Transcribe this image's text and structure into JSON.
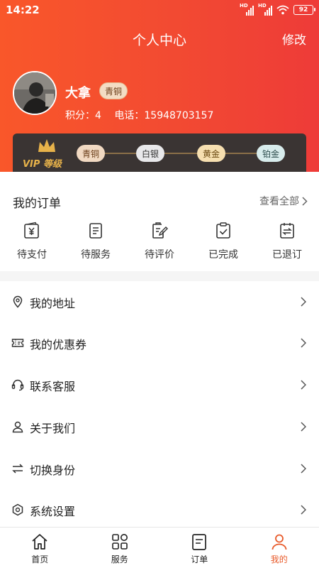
{
  "status_bar": {
    "time": "14:22",
    "hd1": "HD",
    "hd2": "HD",
    "battery": "92"
  },
  "nav": {
    "title": "个人中心",
    "edit_label": "修改"
  },
  "user": {
    "name": "大拿",
    "level": "青铜",
    "points": "积分：4",
    "phone": "电话：15948703157"
  },
  "vip": {
    "label": "VIP 等级",
    "levels": [
      {
        "name": "青铜",
        "bg": "#f1d9c2",
        "fg": "#6b3e1a"
      },
      {
        "name": "白银",
        "bg": "#e8e8ea",
        "fg": "#333333"
      },
      {
        "name": "黄金",
        "bg": "#f6dfb0",
        "fg": "#6b4a12"
      },
      {
        "name": "铂金",
        "bg": "#d8ecec",
        "fg": "#2f4f4f"
      }
    ]
  },
  "orders": {
    "title": "我的订单",
    "view_all": "查看全部",
    "items": [
      {
        "label": "待支付",
        "icon": "wallet-yen-icon"
      },
      {
        "label": "待服务",
        "icon": "document-icon"
      },
      {
        "label": "待评价",
        "icon": "edit-document-icon"
      },
      {
        "label": "已完成",
        "icon": "clipboard-check-icon"
      },
      {
        "label": "已退订",
        "icon": "refund-icon"
      }
    ]
  },
  "menu": [
    {
      "label": "我的地址",
      "icon": "location-pin-icon"
    },
    {
      "label": "我的优惠券",
      "icon": "coupon-icon"
    },
    {
      "label": "联系客服",
      "icon": "headset-icon"
    },
    {
      "label": "关于我们",
      "icon": "person-icon"
    },
    {
      "label": "切换身份",
      "icon": "switch-arrows-icon"
    },
    {
      "label": "系统设置",
      "icon": "settings-hexagon-icon"
    }
  ],
  "tabbar": [
    {
      "label": "首页",
      "icon": "home-icon",
      "active": false
    },
    {
      "label": "服务",
      "icon": "grid-icon",
      "active": false
    },
    {
      "label": "订单",
      "icon": "order-list-icon",
      "active": false
    },
    {
      "label": "我的",
      "icon": "profile-icon",
      "active": true
    }
  ],
  "colors": {
    "accent": "#e85a2a",
    "header_start": "#f9572a",
    "header_end": "#ee3b38",
    "vip_bg": "#3a3433",
    "vip_gold": "#e7b24a"
  }
}
